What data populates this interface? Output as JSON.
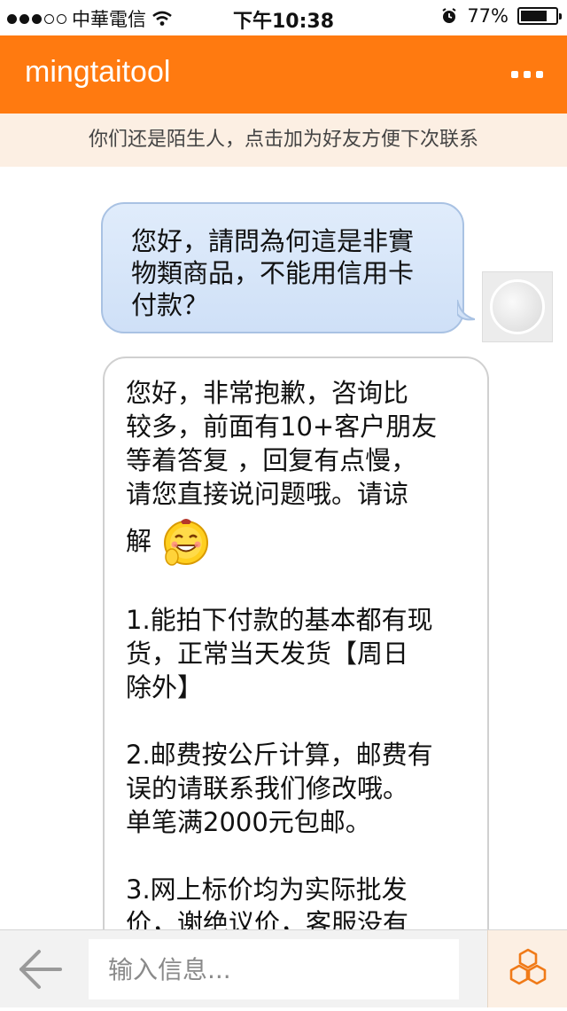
{
  "status_bar": {
    "carrier": "中華電信",
    "time": "下午10:38",
    "battery": "77%",
    "battery_level": 0.77,
    "signal_bars": 3
  },
  "nav": {
    "title": "mingtaitool",
    "more_icon": "more-dots-icon"
  },
  "notice": {
    "text": "你们还是陌生人，点击加为好友方便下次联系"
  },
  "messages": {
    "outgoing": {
      "lines": [
        "您好，請問為何這是非實",
        "物類商品，不能用信用卡",
        "付款？"
      ]
    },
    "incoming": {
      "lines_1": [
        "您好，非常抱歉，咨询比",
        "较多，前面有10+客户朋友",
        "等着答复 ，回复有点慢，",
        "请您直接说问题哦。请谅"
      ],
      "line_emoji": "解",
      "emoji_icon": "grinning-emoji-icon",
      "paragraph_2": [
        "1.能拍下付款的基本都有现",
        "货，正常当天发货【周日",
        "除外】"
      ],
      "paragraph_3": [
        "2.邮费按公斤计算，邮费有",
        "误的请联系我们修改哦。",
        "单笔满2000元包邮。"
      ],
      "paragraph_4": [
        "3.网上标价均为实际批发",
        "价，谢绝议价，客服没有"
      ]
    }
  },
  "input_bar": {
    "placeholder": "输入信息...",
    "value": "",
    "back_icon": "back-arrow-icon",
    "tools_icon": "hexagon-tools-icon"
  },
  "colors": {
    "accent": "#ff7a10",
    "notice_bg": "#fcefe3",
    "outgoing_bubble": "#d6e6f9",
    "incoming_bubble": "#ffffff"
  }
}
